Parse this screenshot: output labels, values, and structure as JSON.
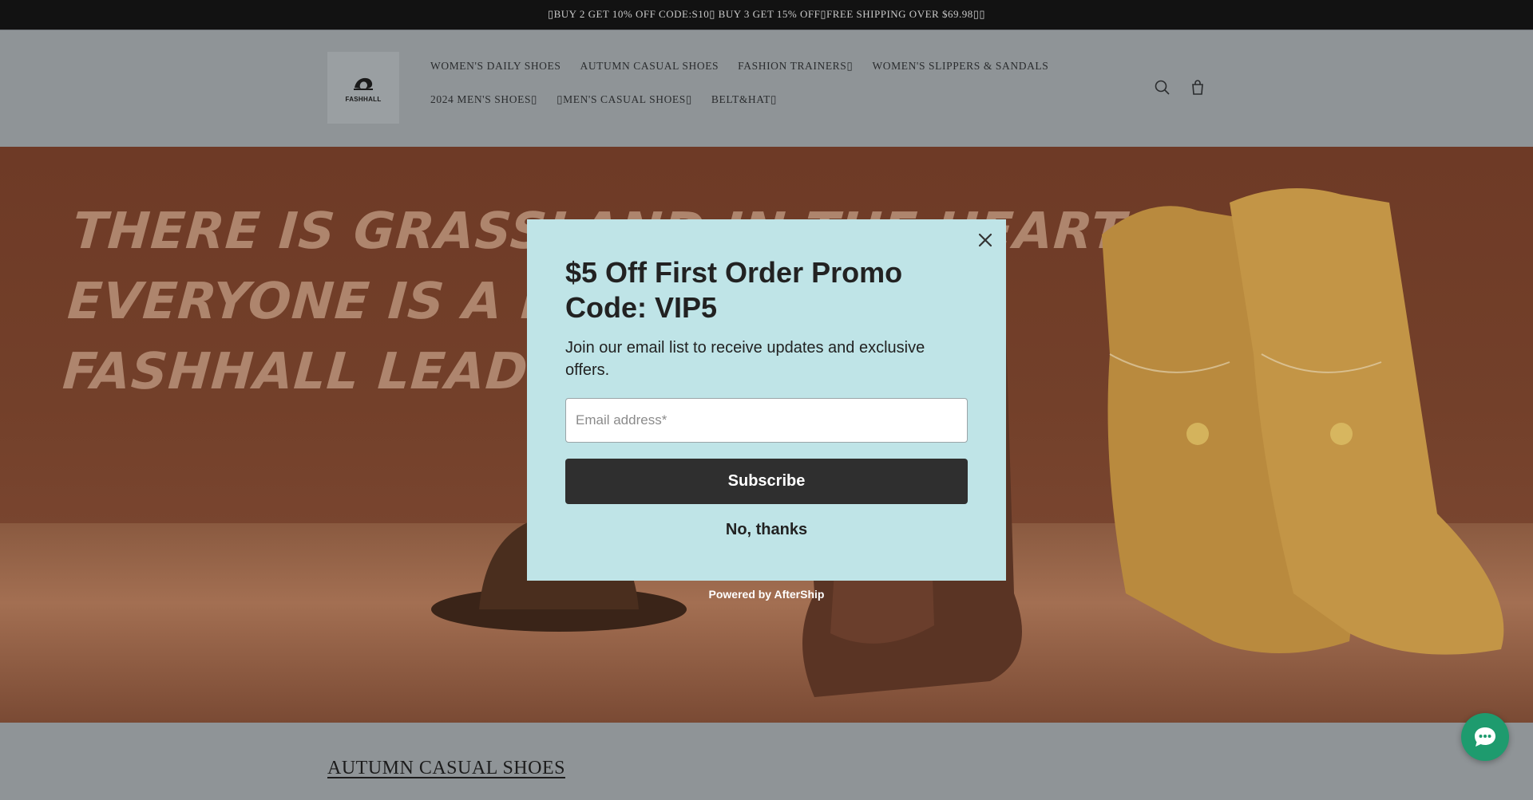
{
  "announcement": {
    "text": "▯BUY 2 GET 10% OFF CODE:S10▯ BUY 3 GET 15% OFF▯FREE SHIPPING OVER $69.98▯▯"
  },
  "header": {
    "logo_text": "FASHHALL",
    "nav_row1": [
      "WOMEN'S DAILY SHOES",
      "AUTUMN CASUAL SHOES",
      "FASHION TRAINERS▯",
      "WOMEN'S SLIPPERS & SANDALS"
    ],
    "nav_row2": [
      "2024 MEN'S SHOES▯",
      "▯MEN'S CASUAL SHOES▯",
      "BELT&HAT▯"
    ],
    "icons": [
      "search-icon",
      "cart-icon"
    ]
  },
  "hero": {
    "lines": [
      "THERE IS GRASSLAND IN THE HEART",
      "EVERYONE IS A KNIGHT",
      "FASHHALL LEADS YOUR DREAM"
    ]
  },
  "section": {
    "title": "AUTUMN CASUAL SHOES"
  },
  "popup": {
    "title": "$5 Off First Order Promo Code: VIP5",
    "description": "Join our email list to receive updates and exclusive offers.",
    "email_placeholder": "Email address*",
    "subscribe_label": "Subscribe",
    "decline_label": "No, thanks",
    "powered_by": "Powered by AfterShip",
    "background_color": "#bfe4e7",
    "button_color": "#2f2f2f"
  },
  "chat": {
    "icon": "chat-bubble-icon",
    "color": "#1e9b6e"
  }
}
